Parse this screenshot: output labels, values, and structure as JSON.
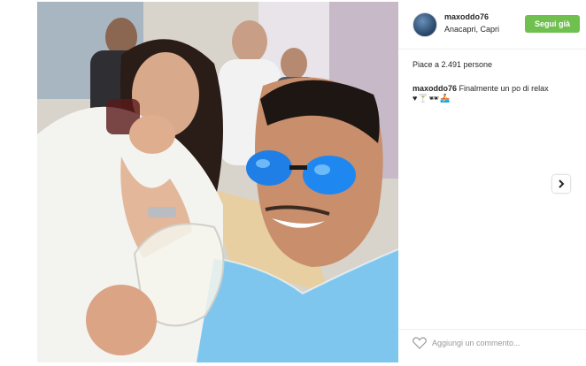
{
  "post": {
    "username": "maxoddo76",
    "location": "Anacapri, Capri",
    "follow_label": "Segui già",
    "likes_text": "Piace a 2.491 persone",
    "caption_user": "maxoddo76",
    "caption_text": "Finalmente un po di relax",
    "caption_emoji": "♥🍸🕶🚣",
    "comment_placeholder": "Aggiungi un commento..."
  },
  "colors": {
    "follow_button": "#70c050",
    "text": "#262626",
    "muted": "#999999"
  },
  "icons": {
    "next": "chevron-right-icon",
    "like": "heart-icon"
  }
}
